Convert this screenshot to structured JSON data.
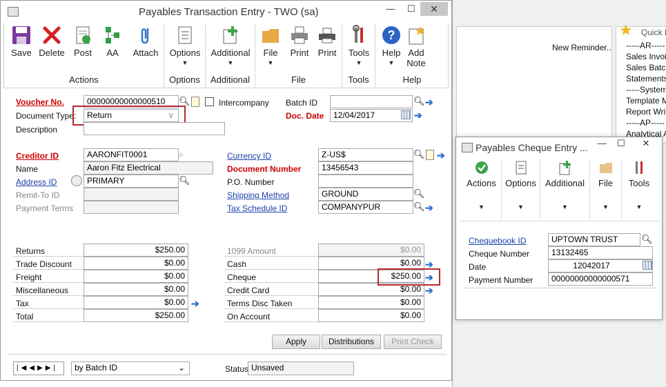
{
  "main": {
    "title": "Payables Transaction Entry  -  TWO (sa)",
    "ribbon": {
      "actions": {
        "label": "Actions",
        "save": "Save",
        "delete": "Delete",
        "post": "Post",
        "aa": "AA",
        "attach": "Attach"
      },
      "options": {
        "label": "Options",
        "btn": "Options"
      },
      "additional": {
        "label": "Additional",
        "btn": "Additional"
      },
      "file": {
        "label": "File",
        "file": "File",
        "print1": "Print",
        "print2": "Print"
      },
      "tools": {
        "label": "Tools",
        "btn": "Tools"
      },
      "help": {
        "label": "Help",
        "help": "Help",
        "addnote": "Add\nNote"
      }
    },
    "voucher_label": "Voucher No.",
    "voucher_value": "00000000000000510",
    "intercompany_label": "Intercompany",
    "batch_label": "Batch ID",
    "batch_value": "",
    "doctype_label": "Document Type:",
    "doctype_value": "Return",
    "docdate_label": "Doc. Date",
    "docdate_value": "12/04/2017",
    "description_label": "Description",
    "description_value": "",
    "creditor_label": "Creditor ID",
    "creditor_value": "AARONFIT0001",
    "currency_label": "Currency ID",
    "currency_value": "Z-US$",
    "name_label": "Name",
    "name_value": "Aaron Fitz Electrical",
    "docnum_label": "Document Number",
    "docnum_value": "13456543",
    "address_label": "Address ID",
    "address_value": "PRIMARY",
    "po_label": "P.O. Number",
    "po_value": "",
    "remit_label": "Remit-To ID",
    "remit_value": "",
    "shipping_label": "Shipping Method",
    "shipping_value": "GROUND",
    "payterms_label": "Payment Terms",
    "payterms_value": "",
    "taxsched_label": "Tax Schedule ID",
    "taxsched_value": "COMPANYPUR",
    "left_amounts": [
      {
        "label": "Returns",
        "value": "$250.00"
      },
      {
        "label": "Trade Discount",
        "value": "$0.00"
      },
      {
        "label": "Freight",
        "value": "$0.00"
      },
      {
        "label": "Miscellaneous",
        "value": "$0.00"
      },
      {
        "label": "Tax",
        "value": "$0.00"
      },
      {
        "label": "Total",
        "value": "$250.00"
      }
    ],
    "right_amounts": [
      {
        "label": "1099 Amount",
        "value": "$0.00"
      },
      {
        "label": "Cash",
        "value": "$0.00"
      },
      {
        "label": "Cheque",
        "value": "$250.00"
      },
      {
        "label": "Credit Card",
        "value": "$0.00"
      },
      {
        "label": "Terms Disc Taken",
        "value": "$0.00"
      },
      {
        "label": "On Account",
        "value": "$0.00"
      }
    ],
    "apply": "Apply",
    "distributions": "Distributions",
    "printcheck": "Print Check",
    "sort_value": "by Batch ID",
    "status_label": "Status",
    "status_value": "Unsaved"
  },
  "background": {
    "new_reminder": "New Reminder..",
    "quick_links_title": "Quick L",
    "quick_links": [
      "-----AR-----",
      "Sales Invoic",
      "Sales Batch",
      "Statements",
      "-----System-",
      "Template M",
      "Report Writ",
      "-----AP-----",
      "Analytical A"
    ]
  },
  "cheque": {
    "title": "Payables Cheque Entry  ...",
    "ribbon": {
      "actions": "Actions",
      "options": "Options",
      "additional": "Additional",
      "file": "File",
      "tools": "Tools"
    },
    "chequebook_label": "Chequebook ID",
    "chequebook_value": "UPTOWN TRUST",
    "chequenum_label": "Cheque Number",
    "chequenum_value": "13132465",
    "date_label": "Date",
    "date_value": "12042017",
    "paynum_label": "Payment Number",
    "paynum_value": "00000000000000571"
  },
  "colors": {
    "required": "#c00000",
    "link": "#1b3fa8",
    "highlight": "#b7282e"
  }
}
